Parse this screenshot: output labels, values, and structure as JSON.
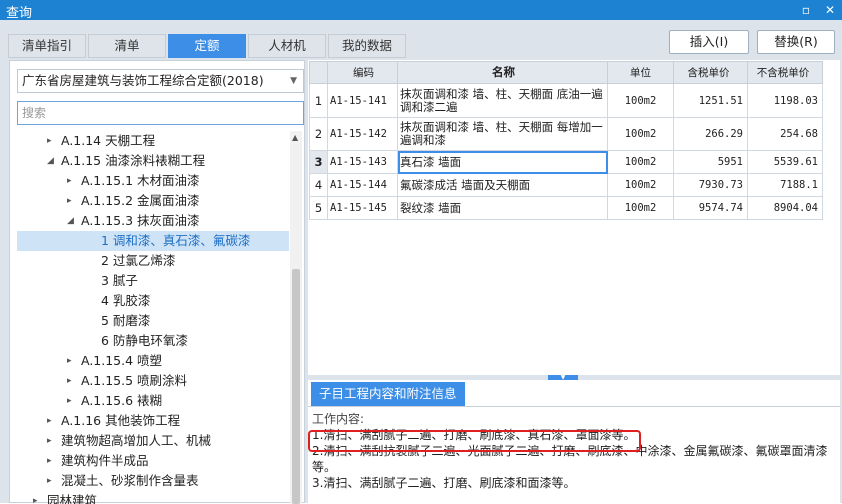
{
  "window": {
    "title": "查询",
    "restore_glyph": "▫",
    "close_glyph": "✕"
  },
  "tabs": [
    {
      "label": "清单指引",
      "active": false
    },
    {
      "label": "清单",
      "active": false
    },
    {
      "label": "定额",
      "active": true
    },
    {
      "label": "人材机",
      "active": false
    },
    {
      "label": "我的数据",
      "active": false
    }
  ],
  "buttons": {
    "insert": "插入(I)",
    "replace": "替换(R)"
  },
  "left": {
    "combo_value": "广东省房屋建筑与装饰工程综合定额(2018)",
    "search_placeholder": "搜索",
    "tree": [
      {
        "label": "A.1.14 天棚工程",
        "toggle": "▸"
      },
      {
        "label": "A.1.15 油漆涂料裱糊工程",
        "toggle": "◢"
      },
      {
        "label": "A.1.15.1 木材面油漆",
        "toggle": "▸"
      },
      {
        "label": "A.1.15.2 金属面油漆",
        "toggle": "▸"
      },
      {
        "label": "A.1.15.3 抹灰面油漆",
        "toggle": "◢"
      },
      {
        "label": "1 调和漆、真石漆、氟碳漆",
        "toggle": "",
        "selected": true
      },
      {
        "label": "2 过氯乙烯漆",
        "toggle": ""
      },
      {
        "label": "3 腻子",
        "toggle": ""
      },
      {
        "label": "4 乳胶漆",
        "toggle": ""
      },
      {
        "label": "5 耐磨漆",
        "toggle": ""
      },
      {
        "label": "6 防静电环氧漆",
        "toggle": ""
      },
      {
        "label": "A.1.15.4 喷塑",
        "toggle": "▸"
      },
      {
        "label": "A.1.15.5 喷刷涂料",
        "toggle": "▸"
      },
      {
        "label": "A.1.15.6 裱糊",
        "toggle": "▸"
      },
      {
        "label": "A.1.16 其他装饰工程",
        "toggle": "▸"
      },
      {
        "label": "建筑物超高增加人工、机械",
        "toggle": "▸"
      },
      {
        "label": "建筑构件半成品",
        "toggle": "▸"
      },
      {
        "label": "混凝土、砂浆制作含量表",
        "toggle": "▸"
      },
      {
        "label": "园林建筑",
        "toggle": "▸"
      }
    ]
  },
  "table": {
    "headers": [
      "",
      "编码",
      "名称",
      "单位",
      "含税单价",
      "不含税单价"
    ],
    "rows": [
      {
        "n": "1",
        "code": "A1-15-141",
        "name": "抹灰面调和漆 墙、柱、天棚面 底油一遍调和漆二遍",
        "unit": "100m2",
        "price_tax": "1251.51",
        "price_notax": "1198.03"
      },
      {
        "n": "2",
        "code": "A1-15-142",
        "name": "抹灰面调和漆 墙、柱、天棚面 每增加一遍调和漆",
        "unit": "100m2",
        "price_tax": "266.29",
        "price_notax": "254.68"
      },
      {
        "n": "3",
        "code": "A1-15-143",
        "name": "真石漆 墙面",
        "unit": "100m2",
        "price_tax": "5951",
        "price_notax": "5539.61"
      },
      {
        "n": "4",
        "code": "A1-15-144",
        "name": "氟碳漆成活 墙面及天棚面",
        "unit": "100m2",
        "price_tax": "7930.73",
        "price_notax": "7188.1"
      },
      {
        "n": "5",
        "code": "A1-15-145",
        "name": "裂纹漆 墙面",
        "unit": "100m2",
        "price_tax": "9574.74",
        "price_notax": "8904.04"
      }
    ]
  },
  "info": {
    "tab_label": "子目工程内容和附注信息",
    "heading": "工作内容:",
    "lines": [
      "1.清扫、满刮腻子二遍、打磨、刷底漆、真石漆、罩面漆等。",
      "2.清扫、满刮抗裂腻子二遍、光面腻子二遍、打磨、刷底漆、中涂漆、金属氟碳漆、氟碳罩面清漆等。",
      "3.清扫、满刮腻子二遍、打磨、刷底漆和面漆等。"
    ]
  },
  "colors": {
    "titlebar": "#1e82d2",
    "accent": "#3d8ee6",
    "highlight": "#e02020"
  }
}
